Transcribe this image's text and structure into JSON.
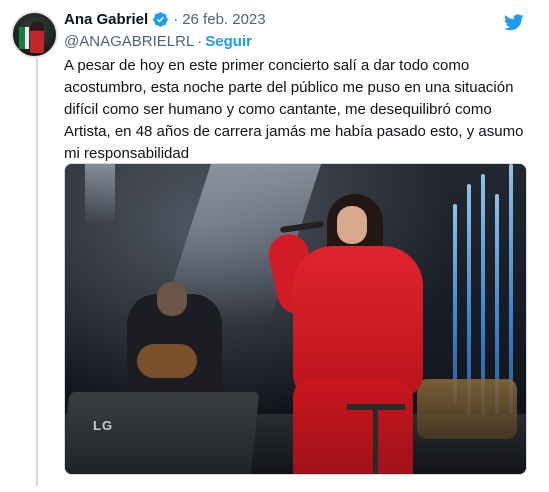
{
  "tweet": {
    "author_name": "Ana Gabriel",
    "separator": "·",
    "date": "26 feb. 2023",
    "handle": "@ANAGABRIELRL",
    "handle_separator": "·",
    "follow_label": "Seguir",
    "text": "A pesar de hoy en este primer concierto salí a dar todo como acostumbro, esta noche parte del público me puso en una situación difícil como ser humano y como cantante, me desequilibró como Artista, en 48 años de carrera jamás me había pasado esto, y asumo mi responsabilidad",
    "media": {
      "monitor_brand": "LG"
    }
  },
  "icons": {
    "verified": "verified-badge-icon",
    "platform": "twitter-bird-icon"
  },
  "colors": {
    "accent": "#1d9bf0",
    "secondary_text": "#536471",
    "primary_text": "#0f1419",
    "thread_line": "#cfd9de"
  }
}
